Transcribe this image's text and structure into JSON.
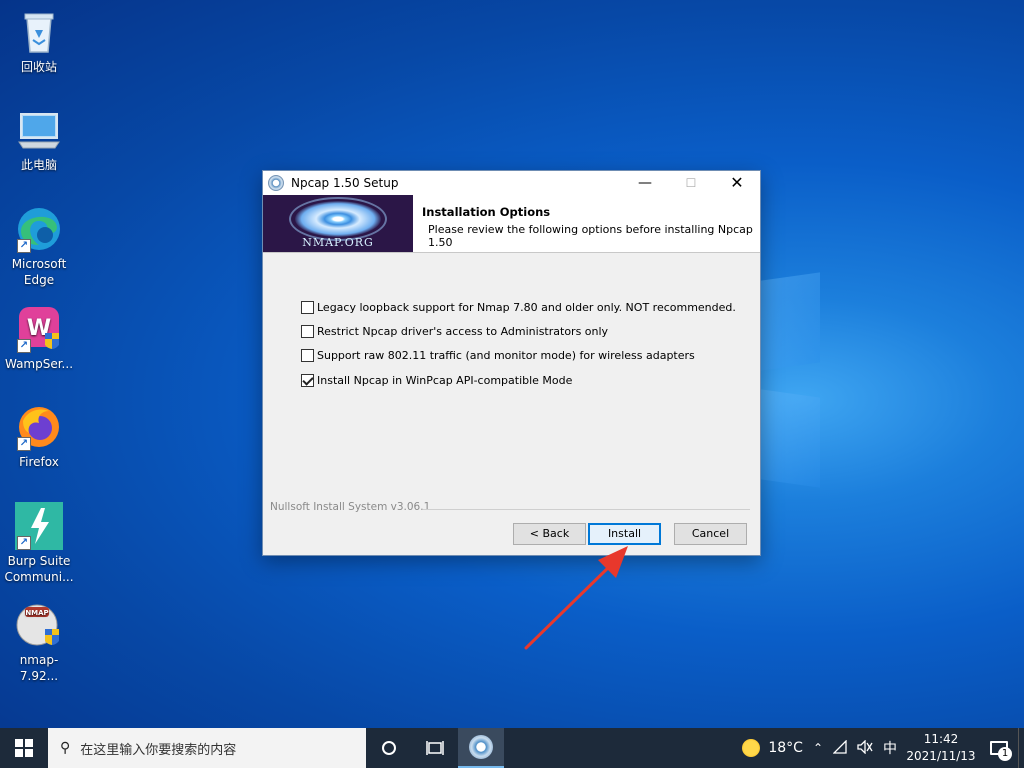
{
  "desktop": {
    "icons": [
      {
        "label": "回收站",
        "icon": "recycle-bin-icon"
      },
      {
        "label": "此电脑",
        "icon": "this-pc-icon"
      },
      {
        "label": "Microsoft Edge",
        "icon": "edge-icon"
      },
      {
        "label": "WampSer...",
        "icon": "wampserver-icon"
      },
      {
        "label": "Firefox",
        "icon": "firefox-icon"
      },
      {
        "label": "Burp Suite Communi...",
        "icon": "burp-suite-icon"
      },
      {
        "label": "nmap-7.92...",
        "icon": "nmap-installer-icon"
      }
    ]
  },
  "dialog": {
    "title": "Npcap 1.50 Setup",
    "banner_label": "NMAP.ORG",
    "header_title": "Installation Options",
    "header_subtitle": "Please review the following options before installing Npcap 1.50",
    "options": [
      {
        "label": "Legacy loopback support for Nmap 7.80 and older only. NOT recommended.",
        "checked": false
      },
      {
        "label": "Restrict Npcap driver's access to Administrators only",
        "checked": false
      },
      {
        "label": "Support raw 802.11 traffic (and monitor mode) for wireless adapters",
        "checked": false
      },
      {
        "label": "Install Npcap in WinPcap API-compatible Mode",
        "checked": true
      }
    ],
    "branding": "Nullsoft Install System v3.06.1",
    "buttons": {
      "back": "< Back",
      "install": "Install",
      "cancel": "Cancel"
    }
  },
  "taskbar": {
    "search_placeholder": "在这里输入你要搜索的内容",
    "weather_temp": "18°C",
    "ime": "中",
    "time": "11:42",
    "date": "2021/11/13",
    "notification_count": "1"
  },
  "colors": {
    "accent": "#0078d7",
    "arrow": "#e8382c",
    "banner": "#2b1647"
  }
}
